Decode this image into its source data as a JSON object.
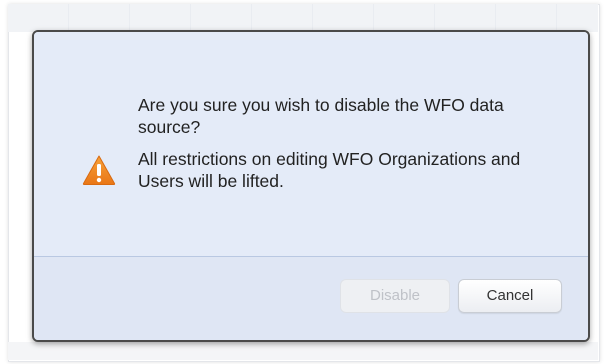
{
  "dialog": {
    "question": "Are you sure you wish to disable the WFO data source?",
    "detail": "All restrictions on editing WFO Organizations and Users will be lifted.",
    "icon": "warning-icon",
    "buttons": {
      "disable_label": "Disable",
      "disable_enabled": false,
      "cancel_label": "Cancel"
    }
  },
  "colors": {
    "dialog_background": "#e4ebf8",
    "footer_background": "#dfe6f4",
    "warning_orange": "#f08a24",
    "dialog_border": "#4a4a4a"
  }
}
